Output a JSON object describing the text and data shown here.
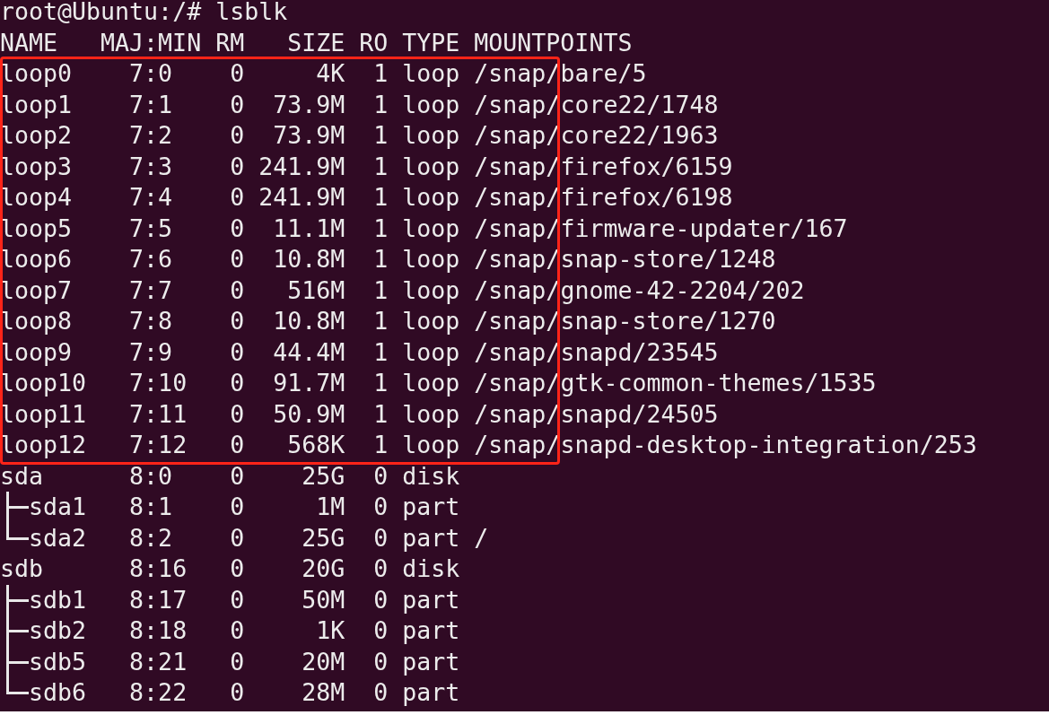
{
  "terminal": {
    "prompt": "root@Ubuntu:/#",
    "command": "lsblk",
    "columns": [
      "NAME",
      "MAJ:MIN",
      "RM",
      "SIZE",
      "RO",
      "TYPE",
      "MOUNTPOINTS"
    ],
    "highlight_box": {
      "kind": "outline",
      "devices": [
        {
          "name": "loop0",
          "maj_min": "7:0",
          "rm": "0",
          "size": "4K",
          "ro": "1",
          "type": "loop",
          "mountpoints": "/snap/bare/5"
        },
        {
          "name": "loop1",
          "maj_min": "7:1",
          "rm": "0",
          "size": "73.9M",
          "ro": "1",
          "type": "loop",
          "mountpoints": "/snap/core22/1748"
        },
        {
          "name": "loop2",
          "maj_min": "7:2",
          "rm": "0",
          "size": "73.9M",
          "ro": "1",
          "type": "loop",
          "mountpoints": "/snap/core22/1963"
        },
        {
          "name": "loop3",
          "maj_min": "7:3",
          "rm": "0",
          "size": "241.9M",
          "ro": "1",
          "type": "loop",
          "mountpoints": "/snap/firefox/6159"
        },
        {
          "name": "loop4",
          "maj_min": "7:4",
          "rm": "0",
          "size": "241.9M",
          "ro": "1",
          "type": "loop",
          "mountpoints": "/snap/firefox/6198"
        },
        {
          "name": "loop5",
          "maj_min": "7:5",
          "rm": "0",
          "size": "11.1M",
          "ro": "1",
          "type": "loop",
          "mountpoints": "/snap/firmware-updater/167"
        },
        {
          "name": "loop6",
          "maj_min": "7:6",
          "rm": "0",
          "size": "10.8M",
          "ro": "1",
          "type": "loop",
          "mountpoints": "/snap/snap-store/1248"
        },
        {
          "name": "loop7",
          "maj_min": "7:7",
          "rm": "0",
          "size": "516M",
          "ro": "1",
          "type": "loop",
          "mountpoints": "/snap/gnome-42-2204/202"
        },
        {
          "name": "loop8",
          "maj_min": "7:8",
          "rm": "0",
          "size": "10.8M",
          "ro": "1",
          "type": "loop",
          "mountpoints": "/snap/snap-store/1270"
        },
        {
          "name": "loop9",
          "maj_min": "7:9",
          "rm": "0",
          "size": "44.4M",
          "ro": "1",
          "type": "loop",
          "mountpoints": "/snap/snapd/23545"
        },
        {
          "name": "loop10",
          "maj_min": "7:10",
          "rm": "0",
          "size": "91.7M",
          "ro": "1",
          "type": "loop",
          "mountpoints": "/snap/gtk-common-themes/1535"
        },
        {
          "name": "loop11",
          "maj_min": "7:11",
          "rm": "0",
          "size": "50.9M",
          "ro": "1",
          "type": "loop",
          "mountpoints": "/snap/snapd/24505"
        },
        {
          "name": "loop12",
          "maj_min": "7:12",
          "rm": "0",
          "size": "568K",
          "ro": "1",
          "type": "loop",
          "mountpoints": "/snap/snapd-desktop-integration/253"
        }
      ]
    },
    "devices": [
      {
        "name": "sda",
        "maj_min": "8:0",
        "rm": "0",
        "size": "25G",
        "ro": "0",
        "type": "disk",
        "children": [
          {
            "name": "sda1",
            "maj_min": "8:1",
            "rm": "0",
            "size": "1M",
            "ro": "0",
            "type": "part"
          },
          {
            "name": "sda2",
            "maj_min": "8:2",
            "rm": "0",
            "size": "25G",
            "ro": "0",
            "type": "part",
            "mountpoints": "/"
          }
        ]
      },
      {
        "name": "sdb",
        "maj_min": "8:16",
        "rm": "0",
        "size": "20G",
        "ro": "0",
        "type": "disk",
        "children": [
          {
            "name": "sdb1",
            "maj_min": "8:17",
            "rm": "0",
            "size": "50M",
            "ro": "0",
            "type": "part"
          },
          {
            "name": "sdb2",
            "maj_min": "8:18",
            "rm": "0",
            "size": "1K",
            "ro": "0",
            "type": "part"
          },
          {
            "name": "sdb5",
            "maj_min": "8:21",
            "rm": "0",
            "size": "20M",
            "ro": "0",
            "type": "part"
          },
          {
            "name": "sdb6",
            "maj_min": "8:22",
            "rm": "0",
            "size": "28M",
            "ro": "0",
            "type": "part"
          }
        ]
      }
    ]
  }
}
